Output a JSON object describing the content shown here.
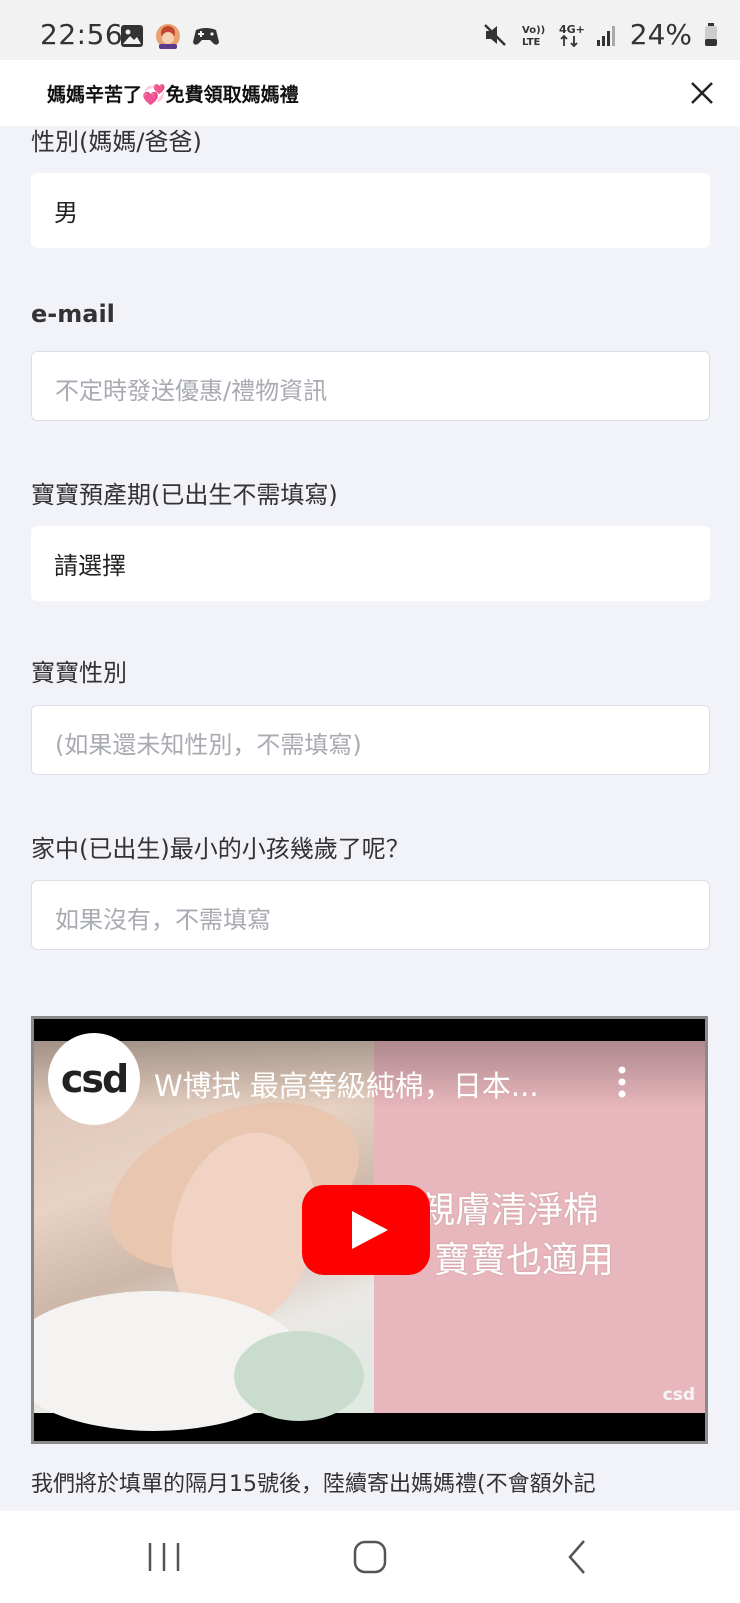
{
  "status_bar": {
    "time": "22:56",
    "battery": "24%",
    "icons_left": [
      "gallery-icon",
      "avatar-notification-icon",
      "game-controller-icon"
    ],
    "icons_right": [
      "mute-icon",
      "volte-icon",
      "4g-data-icon",
      "signal-icon",
      "battery-icon"
    ],
    "volte_label": "Vo))\nLTE",
    "network_label": "4G+"
  },
  "header": {
    "title": "媽媽辛苦了💞免費領取媽媽禮",
    "close_icon": "close-icon"
  },
  "form": {
    "gender": {
      "label": "性別(媽媽/爸爸)",
      "value": "男"
    },
    "email": {
      "label": "e-mail",
      "placeholder": "不定時發送優惠/禮物資訊"
    },
    "due_date": {
      "label": "寶寶預產期(已出生不需填寫)",
      "value": "請選擇"
    },
    "baby_gender": {
      "label": "寶寶性別",
      "placeholder": "(如果還未知性別，不需填寫)"
    },
    "youngest_age": {
      "label": "家中(已出生)最小的小孩幾歲了呢？",
      "placeholder": "如果沒有，不需填寫"
    }
  },
  "video": {
    "channel_logo": "csd",
    "title": "W博拭 最高等級純棉，日本...",
    "overlay_line1": "親膚清淨棉",
    "overlay_line2": "寶寶也適用",
    "watermark": "csd",
    "play_icon": "youtube-play-icon",
    "menu_icon": "more-vert-icon"
  },
  "footer_text": "我們將於填單的隔月15號後，陸續寄出媽媽禮(不會額外記",
  "colors": {
    "page_bg": "#f2f3f9",
    "header_bg": "#ffffff",
    "youtube_red": "#ff0000",
    "pink_panel": "#e8b7bd"
  },
  "nav_bar": {
    "buttons": [
      "recent-apps-icon",
      "home-icon",
      "back-icon"
    ]
  }
}
